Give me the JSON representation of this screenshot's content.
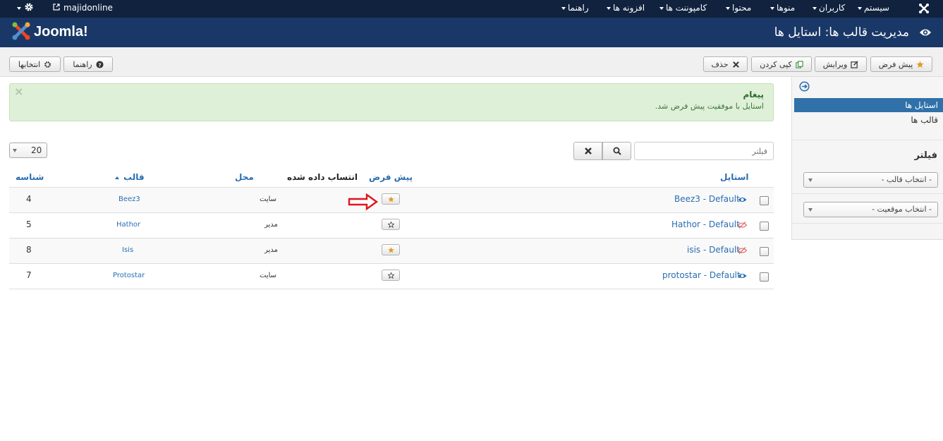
{
  "topnav": {
    "site_name": "majidonline",
    "menus": [
      {
        "label": "سیستم"
      },
      {
        "label": "کاربران"
      },
      {
        "label": "منوها"
      },
      {
        "label": "محتوا"
      },
      {
        "label": "کامپوننت ها"
      },
      {
        "label": "افزونه ها"
      },
      {
        "label": "راهنما"
      }
    ]
  },
  "header": {
    "title": "مدیریت قالب ها: استایل ها",
    "logo_text": "Joomla!"
  },
  "toolbar": {
    "default_label": "پیش فرض",
    "edit_label": "ویرایش",
    "copy_label": "کپی کردن",
    "delete_label": "حذف",
    "help_label": "راهنما",
    "options_label": "انتخابها"
  },
  "sidebar": {
    "items": [
      {
        "label": "استایل ها",
        "active": true
      },
      {
        "label": "قالب ها",
        "active": false
      }
    ],
    "filter_title": "فیلتر",
    "select_template": "- انتخاب قالب -",
    "select_location": "- انتخاب موقعیت -"
  },
  "message": {
    "title": "پیغام",
    "text": "استایل با موفقیت پیش فرض شد.",
    "close": "×"
  },
  "list": {
    "limit": "20",
    "search_placeholder": "فیلتر"
  },
  "table": {
    "headers": {
      "style": "استایل",
      "default": "پیش فرض",
      "assigned": "انتساب داده شده",
      "location": "محل",
      "template": "قالب",
      "id": "شناسه"
    },
    "rows": [
      {
        "style": "Beez3 - Default",
        "visible": true,
        "is_default": true,
        "location": "سایت",
        "template": "Beez3",
        "id": "4"
      },
      {
        "style": "Hathor - Default",
        "visible": false,
        "is_default": false,
        "location": "مدیر",
        "template": "Hathor",
        "id": "5"
      },
      {
        "style": "isis - Default",
        "visible": false,
        "is_default": true,
        "location": "مدیر",
        "template": "Isis",
        "id": "8"
      },
      {
        "style": "protostar - Default",
        "visible": true,
        "is_default": false,
        "location": "سایت",
        "template": "Protostar",
        "id": "7"
      }
    ]
  },
  "colors": {
    "topbar": "#10223e",
    "header": "#1a3867",
    "link": "#2a6db0",
    "success_bg": "#dff0d8",
    "star": "#e29a25",
    "annotation": "#e0161c"
  }
}
